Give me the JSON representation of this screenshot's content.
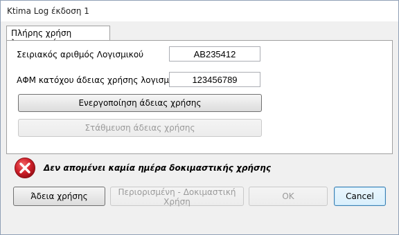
{
  "window": {
    "title": "Ktima Log έκδοση 1"
  },
  "tab": {
    "label": "Πλήρης χρήση λογισμικού"
  },
  "form": {
    "serial_label": "Σειριακός αριθμός Λογισμικού",
    "serial_value": "AB235412",
    "afm_label": "ΑΦΜ κατόχου άδειας χρήσης λογισμικού",
    "afm_value": "123456789",
    "activate_label": "Ενεργοποίηση άδειας χρήσης",
    "park_label": "Στάθμευση άδειας χρήσης"
  },
  "status": {
    "message": "Δεν απομένει καμία ημέρα δοκιμαστικής χρήσης",
    "icon": "error-icon",
    "icon_color": "#d0202a"
  },
  "footer": {
    "license_label": "Άδεια χρήσης",
    "trial_label": "Περιορισμένη - Δοκιμαστική Χρήση",
    "ok_label": "OK",
    "cancel_label": "Cancel"
  }
}
